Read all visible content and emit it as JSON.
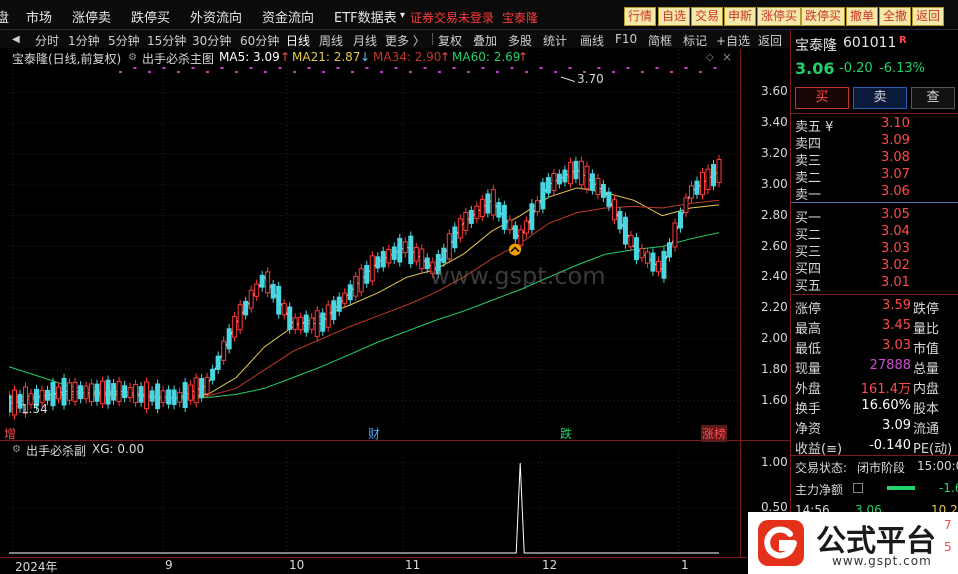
{
  "menu": {
    "items": [
      "盘",
      "市场",
      "涨停卖",
      "跌停买",
      "外资流向",
      "资金流向",
      "ETF数据表"
    ],
    "alert": "证券交易未登录",
    "alert2": "宝泰隆",
    "buttons": [
      "行情",
      "自选",
      "交易",
      "申斯",
      "涨停买",
      "跌停买",
      "撤单",
      "全撤",
      "返回"
    ]
  },
  "toolbar2": {
    "periods": [
      "分时",
      "1分钟",
      "5分钟",
      "15分钟",
      "30分钟",
      "60分钟",
      "日线",
      "周线",
      "月线",
      "更多 〉"
    ],
    "tools": [
      "复权",
      "叠加",
      "多股",
      "统计",
      "画线",
      "F10",
      "简框",
      "标记",
      "+自选",
      "返回"
    ],
    "active": "日线"
  },
  "chart_header": {
    "name": "宝泰隆(日线,前复权)",
    "indicator": "出手必杀主图",
    "ma5": "MA5: 3.09",
    "ma21": "MA21: 2.87",
    "ma34": "MA34: 2.90",
    "ma60": "MA60: 2.69",
    "high_marker": "3.70",
    "low_marker": "1.54"
  },
  "sub_header": {
    "indicator": "出手必杀副",
    "xg": "XG: 0.00"
  },
  "events": {
    "left": "增",
    "cai": "财",
    "die": "跌",
    "zhang": "涨榜"
  },
  "watermark": "www.gspt.com",
  "chart_data": [
    {
      "type": "line",
      "title": "宝泰隆(日线,前复权)",
      "x": [
        "2024年",
        "9",
        "10",
        "11",
        "12",
        "1"
      ],
      "ylim": [
        1.5,
        3.7
      ],
      "yticks": [
        1.6,
        1.8,
        2.0,
        2.2,
        2.4,
        2.6,
        2.8,
        3.0,
        3.2,
        3.4,
        3.6
      ],
      "series": [
        {
          "name": "MA5",
          "values": [
            1.58,
            1.62,
            1.66,
            1.65,
            1.66,
            1.63,
            1.62,
            1.7,
            2.1,
            2.4,
            2.1,
            2.1,
            2.3,
            2.5,
            2.6,
            2.45,
            2.75,
            2.9,
            2.65,
            3.0,
            3.1,
            2.95,
            2.6,
            2.45,
            2.95,
            3.09
          ]
        },
        {
          "name": "MA21",
          "values": [
            1.62,
            1.63,
            1.64,
            1.64,
            1.64,
            1.63,
            1.62,
            1.64,
            1.75,
            1.95,
            2.08,
            2.15,
            2.22,
            2.3,
            2.4,
            2.45,
            2.55,
            2.7,
            2.8,
            2.92,
            2.98,
            2.95,
            2.9,
            2.8,
            2.85,
            2.87
          ]
        },
        {
          "name": "MA34",
          "values": [
            1.6,
            1.61,
            1.62,
            1.63,
            1.63,
            1.63,
            1.62,
            1.63,
            1.68,
            1.8,
            1.92,
            2.0,
            2.08,
            2.15,
            2.22,
            2.3,
            2.4,
            2.52,
            2.62,
            2.75,
            2.82,
            2.85,
            2.86,
            2.85,
            2.88,
            2.9
          ]
        },
        {
          "name": "MA60",
          "values": [
            1.82,
            1.76,
            1.7,
            1.66,
            1.64,
            1.62,
            1.61,
            1.62,
            1.64,
            1.68,
            1.75,
            1.82,
            1.9,
            1.98,
            2.05,
            2.12,
            2.18,
            2.25,
            2.32,
            2.4,
            2.48,
            2.55,
            2.58,
            2.6,
            2.65,
            2.69
          ]
        }
      ]
    },
    {
      "type": "line",
      "title": "出手必杀副",
      "ylim": [
        0,
        1.0
      ],
      "yticks": [
        0.5,
        1.0
      ],
      "series": [
        {
          "name": "XG",
          "values": [
            0,
            0,
            0,
            0,
            0,
            0,
            0,
            0,
            0,
            0,
            0,
            0,
            0,
            0,
            0,
            0,
            0,
            0,
            1,
            0,
            0,
            0,
            0,
            0,
            0,
            0
          ]
        }
      ]
    }
  ],
  "stock": {
    "name": "宝泰隆",
    "code": "601011",
    "tag": "R",
    "price": "3.06",
    "change": "-0.20",
    "pct": "-6.13%",
    "buy_btn": "买",
    "sell_btn": "卖",
    "check_btn": "查"
  },
  "orderbook": {
    "asks": [
      {
        "label": "卖五 ¥",
        "price": "3.10"
      },
      {
        "label": "卖四",
        "price": "3.09"
      },
      {
        "label": "卖三",
        "price": "3.08"
      },
      {
        "label": "卖二",
        "price": "3.07"
      },
      {
        "label": "卖一",
        "price": "3.06"
      }
    ],
    "bids": [
      {
        "label": "买一",
        "price": "3.05"
      },
      {
        "label": "买二",
        "price": "3.04"
      },
      {
        "label": "买三",
        "price": "3.03"
      },
      {
        "label": "买四",
        "price": "3.02"
      },
      {
        "label": "买五",
        "price": "3.01"
      }
    ]
  },
  "stats": [
    {
      "l1": "涨停",
      "v1": "3.59",
      "c1": "red",
      "l2": "跌停"
    },
    {
      "l1": "最高",
      "v1": "3.45",
      "c1": "red",
      "l2": "量比"
    },
    {
      "l1": "最低",
      "v1": "3.03",
      "c1": "red",
      "l2": "市值"
    },
    {
      "l1": "现量",
      "v1": "27888",
      "c1": "purple",
      "l2": "总量"
    },
    {
      "l1": "外盘",
      "v1": "161.4万",
      "c1": "red",
      "l2": "内盘"
    },
    {
      "l1": "换手",
      "v1": "16.60%",
      "c1": "white",
      "l2": "股本"
    },
    {
      "l1": "净资",
      "v1": "3.09",
      "c1": "white",
      "l2": "流通"
    },
    {
      "l1": "收益(≡)",
      "v1": "-0.140",
      "c1": "white",
      "l2": "PE(动)"
    }
  ],
  "status": {
    "label": "交易状态:",
    "value": "闭市阶段",
    "time": "15:00:0"
  },
  "netflow": {
    "label": "主力净额",
    "value": "-1.6"
  },
  "tick_row": {
    "time": "14:56",
    "price": "3.06",
    "vol": "10.2"
  },
  "logo": {
    "text": "公式平台",
    "url": "www.gspt.com"
  }
}
